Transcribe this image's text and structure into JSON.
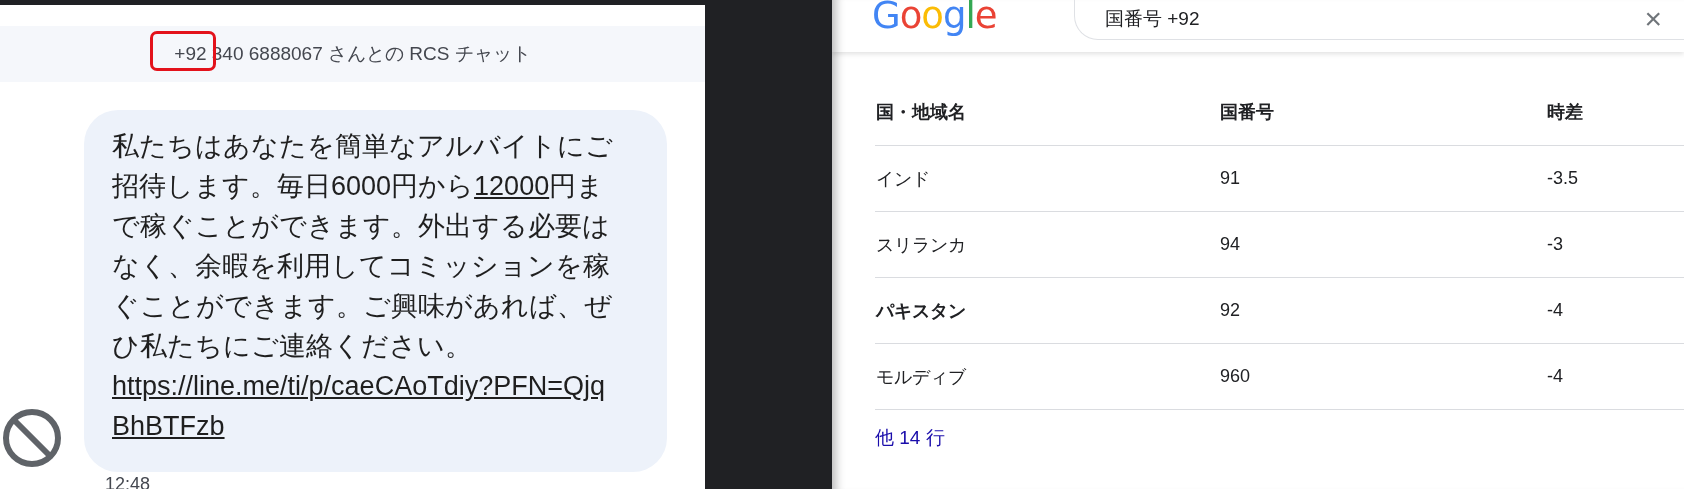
{
  "chat": {
    "header": "+92 340 6888067 さんとの RCS チャット",
    "message": [
      {
        "kind": "text",
        "text": "私たちはあなたを簡単なアルバイトにご招待します。毎日6000円から"
      },
      {
        "kind": "link",
        "text": "12000"
      },
      {
        "kind": "text",
        "text": "円まで稼ぐことができます。外出する必要はなく、余暇を利用してコミッションを稼ぐことができます。ご興味があれば、ぜひ私たちにご連絡ください。"
      }
    ],
    "url": "https://line.me/ti/p/caeCAoTdiy?PFN=QjqBhBTFzb",
    "time": "12:48"
  },
  "search": {
    "logo": "Google",
    "query": "国番号 +92",
    "clear": "×",
    "table": {
      "columns": [
        "国・地域名",
        "国番号",
        "時差"
      ],
      "rows": [
        {
          "cells": [
            "インド",
            "91",
            "-3.5"
          ],
          "bold": false
        },
        {
          "cells": [
            "スリランカ",
            "94",
            "-3"
          ],
          "bold": false
        },
        {
          "cells": [
            "パキスタン",
            "92",
            "-4"
          ],
          "bold": true
        },
        {
          "cells": [
            "モルディブ",
            "960",
            "-4"
          ],
          "bold": false
        }
      ]
    },
    "more": "他 14 行"
  }
}
